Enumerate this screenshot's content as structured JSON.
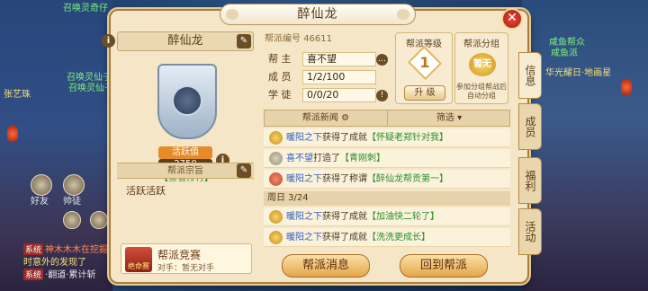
{
  "background": {
    "left_texts": [
      "召唤灵奇仔",
      "召唤灵仙子",
      "召唤灵仙子"
    ],
    "left_names": [
      "张艺珠",
      "好友",
      "帅徒"
    ],
    "right_texts": [
      "咸鱼帮众",
      "咸鱼派",
      "华光耀日·地画星"
    ],
    "chat": [
      {
        "tag": "系统",
        "text": "神木木木在挖掘"
      },
      {
        "tag": "",
        "text": "时意外的发现了"
      },
      {
        "tag": "系统",
        "text": "·翻道·累计斩"
      }
    ]
  },
  "panel": {
    "title": "醉仙龙",
    "close": "✕"
  },
  "guild": {
    "name": "醉仙龙",
    "active_badge": "活跃值",
    "active_score": "2750",
    "rank_link": "【查看排行】",
    "purpose_header": "帮派宗旨",
    "purpose_text": "活跃活跃",
    "battle_title": "帮派竞赛",
    "battle_sub": "对手：暂无对手",
    "battle_icon_text": "绝命赛"
  },
  "stats": {
    "guild_no_label": "帮派编号",
    "guild_no": "46611",
    "leader_label": "帮 主",
    "leader": "喜不望",
    "members_label": "成 员",
    "members": "1/2/100",
    "apprentice_label": "学 徒",
    "apprentice": "0/0/20"
  },
  "level": {
    "title": "帮派等级",
    "value": "1",
    "upgrade": "升 级"
  },
  "group": {
    "title": "帮派分组",
    "value": "暂无",
    "note": "参加分组帮战后自动分组"
  },
  "news": {
    "tab_news": "帮派新闻",
    "tab_filter": "筛选",
    "date": "周日 3/24",
    "items": [
      {
        "name": "暖阳之下",
        "act": "获得了成就",
        "val": "【怀疑老郑针对我】",
        "icon": "gold"
      },
      {
        "name": "喜不望",
        "act": "打造了",
        "val": "【青刚刺】",
        "icon": "gray"
      },
      {
        "name": "暖阳之下",
        "act": "获得了称谓",
        "val": "【醉仙龙帮贡第一】",
        "icon": "red"
      },
      {
        "name": "暖阳之下",
        "act": "获得了成就",
        "val": "【加油快二轮了】",
        "icon": "gold"
      },
      {
        "name": "暖阳之下",
        "act": "获得了成就",
        "val": "【洗洗更成长】",
        "icon": "gold"
      }
    ]
  },
  "buttons": {
    "guild_msg": "帮派消息",
    "return_guild": "回到帮派"
  },
  "tabs": [
    "信息",
    "成员",
    "福利",
    "活动"
  ]
}
